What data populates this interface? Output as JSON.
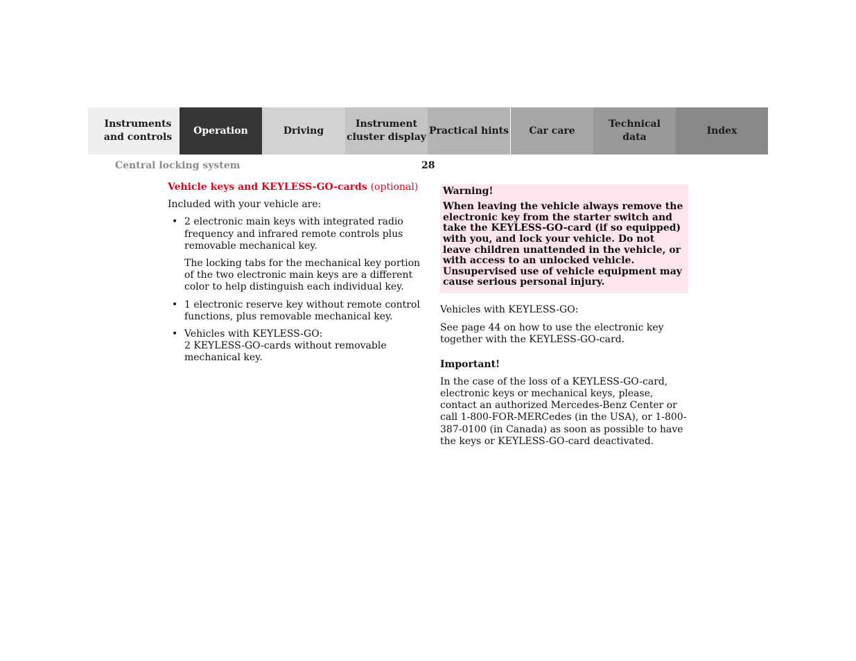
{
  "nav": {
    "tabs": [
      {
        "label": "Instruments\nand controls",
        "active": false
      },
      {
        "label": "Operation",
        "active": true
      },
      {
        "label": "Driving",
        "active": false
      },
      {
        "label": "Instrument\ncluster display",
        "active": false
      },
      {
        "label": "Practical hints",
        "active": false
      },
      {
        "label": "Car care",
        "active": false
      },
      {
        "label": "Technical\ndata",
        "active": false
      },
      {
        "label": "Index",
        "active": false
      }
    ]
  },
  "header": {
    "section_title": "Central locking system",
    "page_number": "28"
  },
  "left": {
    "heading": "Vehicle keys and KEYLESS-GO-cards",
    "heading_optional": "(optional)",
    "intro": "Included with your vehicle are:",
    "bullets": [
      {
        "text": "2 electronic main keys with integrated radio frequency and infrared remote controls plus removable mechanical key.",
        "sub": "The locking tabs for the mechanical key portion of the two electronic main keys are a different color to help distinguish each individual key."
      },
      {
        "text": "1 electronic reserve key without remote control functions, plus removable mechanical key."
      },
      {
        "text_line1": "Vehicles with KEYLESS-GO:",
        "text_line2": "2 KEYLESS-GO-cards without removable mechanical key."
      }
    ],
    "bullet_glyph": "•"
  },
  "right": {
    "warning": {
      "title": "Warning!",
      "body": "When leaving the vehicle always remove the electronic key from the starter switch and take the KEYLESS-GO-card (if so equipped) with you, and lock your vehicle. Do not leave children unattended in the vehicle, or with access to an unlocked vehicle. Unsupervised use of vehicle equipment may cause serious personal injury."
    },
    "keyless_label": "Vehicles with KEYLESS-GO:",
    "keyless_text": "See page 44 on how to use the electronic key together with the KEYLESS-GO-card.",
    "important_title": "Important!",
    "important_text": "In the case of the loss of a KEYLESS-GO-card, electronic keys or mechanical keys, please, contact an authorized Mercedes-Benz Center or call 1-800-FOR-MERCedes (in the USA), or 1-800-387-0100 (in Canada) as soon as possible to have the keys or KEYLESS-GO-card deactivated."
  },
  "colors": {
    "heading_red": "#e2001a",
    "warning_bg": "#fde5ec",
    "active_tab": "#363636",
    "section_title_gray": "#8a8a8a"
  }
}
